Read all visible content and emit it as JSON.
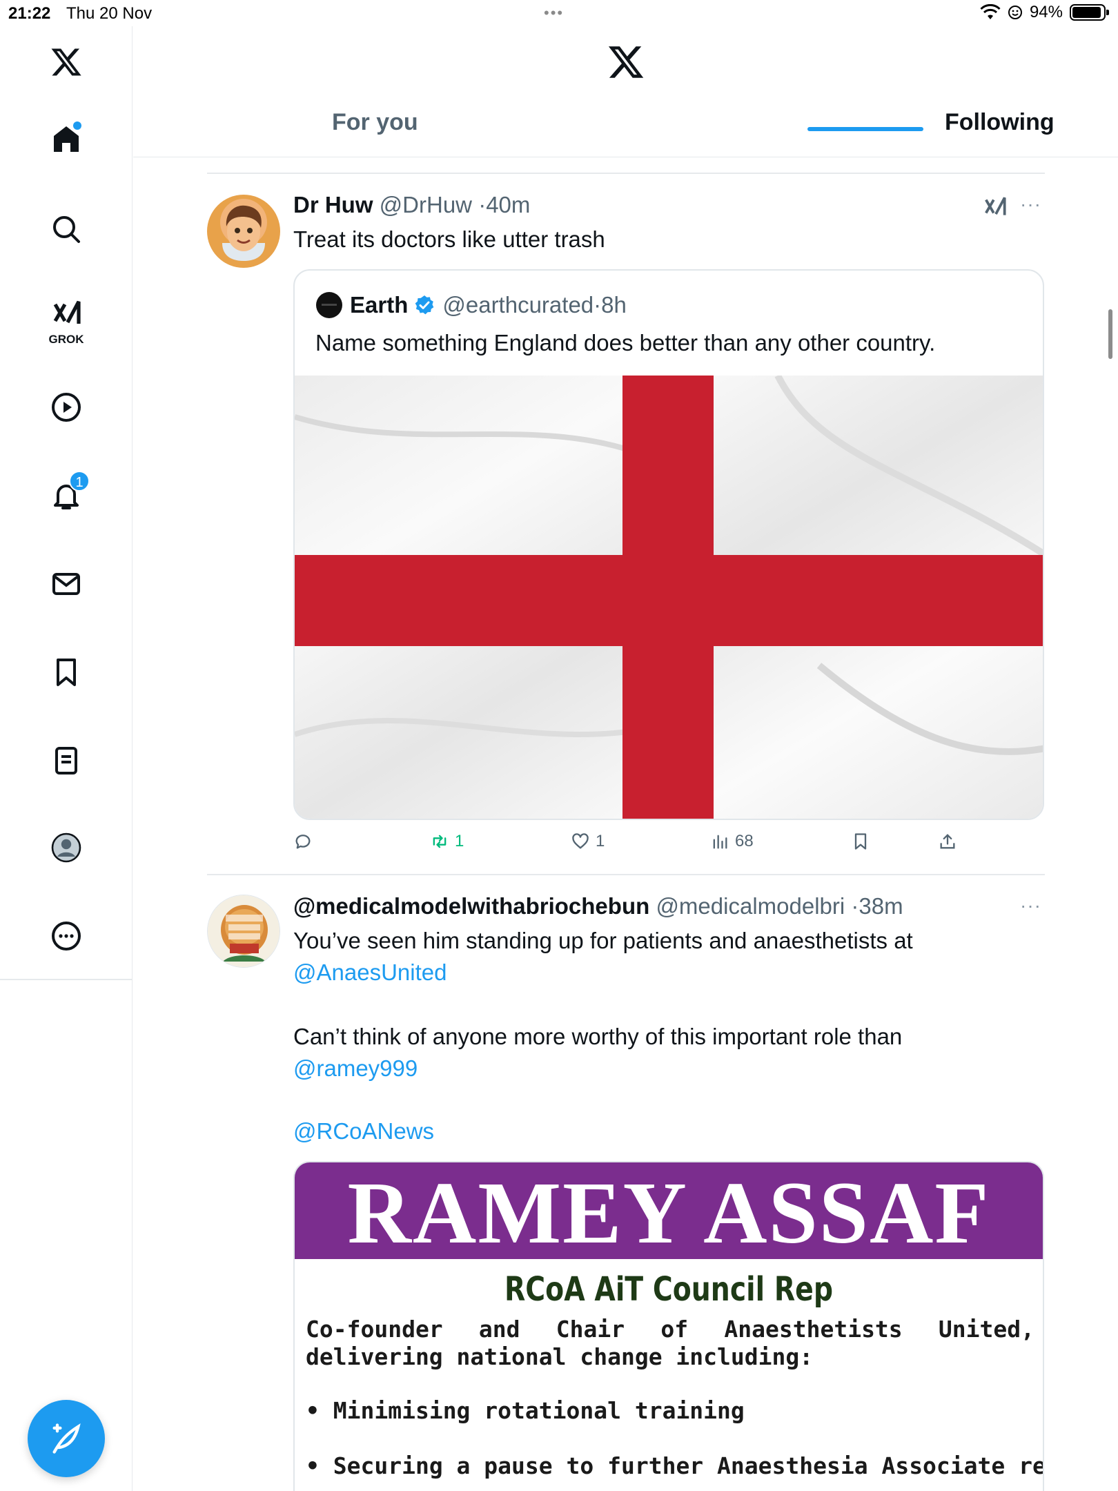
{
  "status_bar": {
    "time": "21:22",
    "date": "Thu 20 Nov",
    "battery": "94%",
    "battery_level": 0.94
  },
  "sidebar": {
    "items": [
      {
        "icon": "x-logo-icon"
      },
      {
        "icon": "home-icon",
        "active": true
      },
      {
        "icon": "search-icon"
      },
      {
        "icon": "grok-icon",
        "label": "GROK"
      },
      {
        "icon": "play-icon"
      },
      {
        "icon": "bell-icon",
        "badge": "1"
      },
      {
        "icon": "mail-icon"
      },
      {
        "icon": "bookmark-icon"
      },
      {
        "icon": "list-icon"
      },
      {
        "icon": "profile-icon"
      },
      {
        "icon": "more-icon"
      }
    ],
    "compose_icon": "compose-feather-icon"
  },
  "header": {
    "tabs": [
      {
        "label": "For you",
        "active": false
      },
      {
        "label": "Following",
        "active": true
      }
    ]
  },
  "tweets": [
    {
      "name": "Dr Huw",
      "handle": "@DrHuw",
      "time": "40m",
      "text": "Treat its doctors like utter trash",
      "quote": {
        "name": "Earth",
        "verified": true,
        "handle": "@earthcurated",
        "time": "8h",
        "text": "Name something England does better than any other country.",
        "image": "england-flag"
      },
      "actions": {
        "replies": "",
        "retweets": "1",
        "likes": "1",
        "views": "68"
      }
    },
    {
      "name": "@medicalmodelwithabriochebun",
      "handle": "@medicalmodelbri",
      "time": "38m",
      "text_line1": "You’ve seen him standing up for patients and anaesthetists at",
      "mention1": "@AnaesUnited",
      "text_line2": "Can’t think of anyone more worthy of this important role than",
      "mention2": "@ramey999",
      "mention3": "@RCoANews",
      "poster": {
        "title": "RAMEY ASSAF",
        "subtitle": "RCoA AiT Council Rep",
        "body": "Co-founder and Chair of Anaesthetists United, delivering national change including:",
        "bullets": [
          "Minimising rotational training",
          "Securing a pause to further Anaesthesia Associate recruitment"
        ]
      }
    }
  ],
  "colors": {
    "accent": "#1d9bf0",
    "retweet": "#00ba7c",
    "text_secondary": "#536471",
    "flag_red": "#c8202f",
    "poster_purple": "#7b2d8e"
  }
}
